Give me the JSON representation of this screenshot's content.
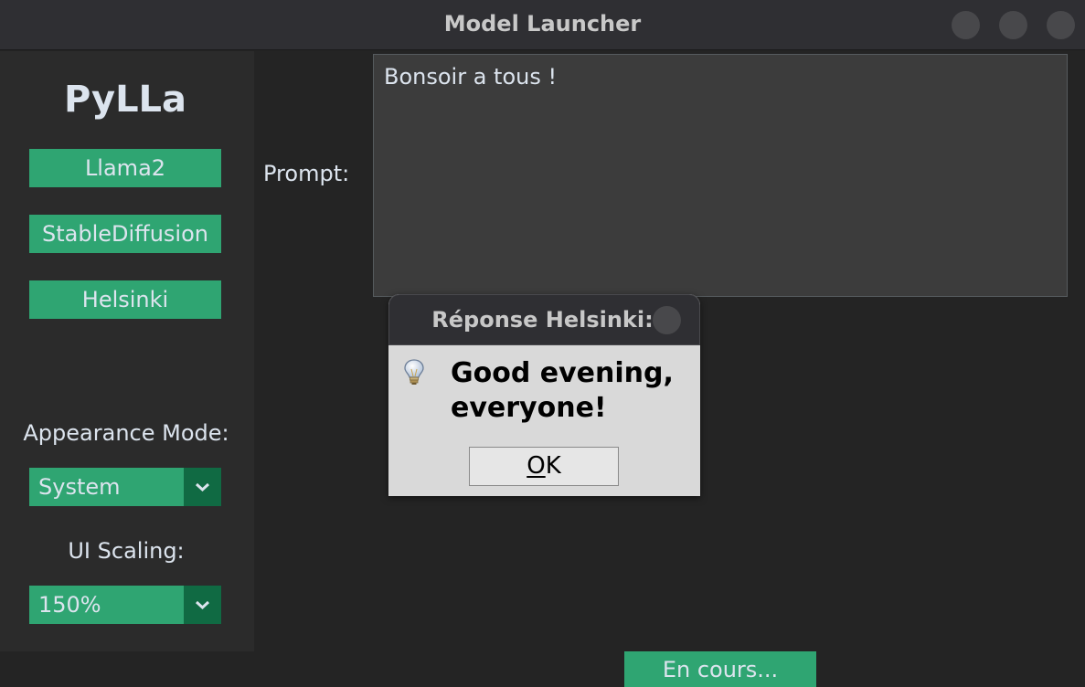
{
  "window": {
    "title": "Model Launcher"
  },
  "sidebar": {
    "logo": "PyLLa",
    "models": [
      {
        "label": "Llama2"
      },
      {
        "label": "StableDiffusion"
      },
      {
        "label": "Helsinki"
      }
    ],
    "appearance_label": "Appearance Mode:",
    "appearance_value": "System",
    "scaling_label": "UI Scaling:",
    "scaling_value": "150%"
  },
  "main": {
    "prompt_label": "Prompt:",
    "prompt_text": "Bonsoir a tous !",
    "status_button": "En cours..."
  },
  "dialog": {
    "title": "Réponse Helsinki:",
    "message": "Good evening, everyone!",
    "ok_label": "OK",
    "icon": "lightbulb-icon"
  },
  "colors": {
    "accent": "#2fa572",
    "accent_dark": "#106a43",
    "background": "#242424",
    "sidebar": "#2b2b2b",
    "titlebar": "#2f2f33",
    "textbox": "#3c3c3c",
    "dialog_bg": "#d9d9d9"
  }
}
